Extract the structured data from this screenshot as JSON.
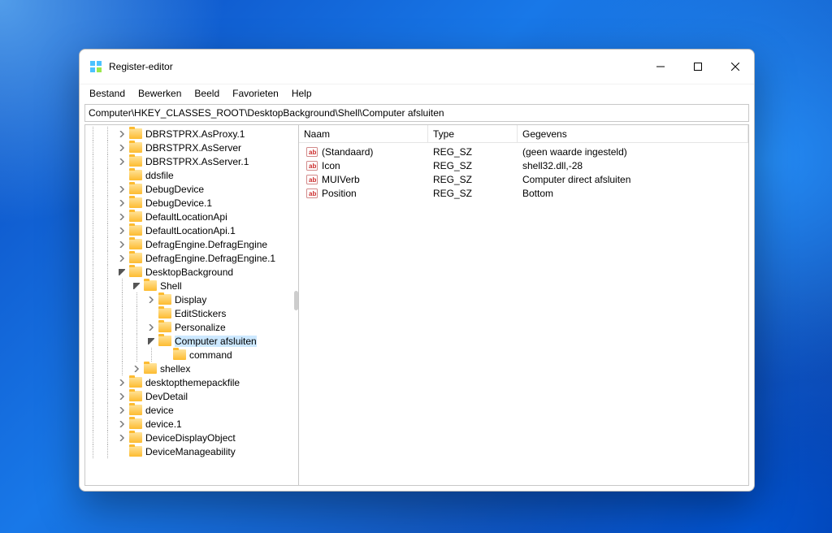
{
  "title": "Register-editor",
  "menus": [
    "Bestand",
    "Bewerken",
    "Beeld",
    "Favorieten",
    "Help"
  ],
  "address": "Computer\\HKEY_CLASSES_ROOT\\DesktopBackground\\Shell\\Computer afsluiten",
  "tree": [
    {
      "indent": 2,
      "exp": "right",
      "label": "DBRSTPRX.AsProxy.1"
    },
    {
      "indent": 2,
      "exp": "right",
      "label": "DBRSTPRX.AsServer"
    },
    {
      "indent": 2,
      "exp": "right",
      "label": "DBRSTPRX.AsServer.1"
    },
    {
      "indent": 2,
      "exp": "none",
      "label": "ddsfile"
    },
    {
      "indent": 2,
      "exp": "right",
      "label": "DebugDevice"
    },
    {
      "indent": 2,
      "exp": "right",
      "label": "DebugDevice.1"
    },
    {
      "indent": 2,
      "exp": "right",
      "label": "DefaultLocationApi"
    },
    {
      "indent": 2,
      "exp": "right",
      "label": "DefaultLocationApi.1"
    },
    {
      "indent": 2,
      "exp": "right",
      "label": "DefragEngine.DefragEngine"
    },
    {
      "indent": 2,
      "exp": "right",
      "label": "DefragEngine.DefragEngine.1"
    },
    {
      "indent": 2,
      "exp": "down",
      "label": "DesktopBackground"
    },
    {
      "indent": 3,
      "exp": "down",
      "label": "Shell"
    },
    {
      "indent": 4,
      "exp": "right",
      "label": "Display"
    },
    {
      "indent": 4,
      "exp": "none",
      "label": "EditStickers"
    },
    {
      "indent": 4,
      "exp": "right",
      "label": "Personalize"
    },
    {
      "indent": 4,
      "exp": "down",
      "label": "Computer afsluiten",
      "selected": true
    },
    {
      "indent": 5,
      "exp": "none",
      "label": "command"
    },
    {
      "indent": 3,
      "exp": "right",
      "label": "shellex"
    },
    {
      "indent": 2,
      "exp": "right",
      "label": "desktopthemepackfile"
    },
    {
      "indent": 2,
      "exp": "right",
      "label": "DevDetail"
    },
    {
      "indent": 2,
      "exp": "right",
      "label": "device"
    },
    {
      "indent": 2,
      "exp": "right",
      "label": "device.1"
    },
    {
      "indent": 2,
      "exp": "right",
      "label": "DeviceDisplayObject"
    },
    {
      "indent": 2,
      "exp": "none",
      "label": "DeviceManageability"
    }
  ],
  "listHeaders": {
    "name": "Naam",
    "type": "Type",
    "data": "Gegevens"
  },
  "values": [
    {
      "name": "(Standaard)",
      "type": "REG_SZ",
      "data": "(geen waarde ingesteld)"
    },
    {
      "name": "Icon",
      "type": "REG_SZ",
      "data": "shell32.dll,-28"
    },
    {
      "name": "MUIVerb",
      "type": "REG_SZ",
      "data": "Computer direct afsluiten"
    },
    {
      "name": "Position",
      "type": "REG_SZ",
      "data": "Bottom"
    }
  ]
}
